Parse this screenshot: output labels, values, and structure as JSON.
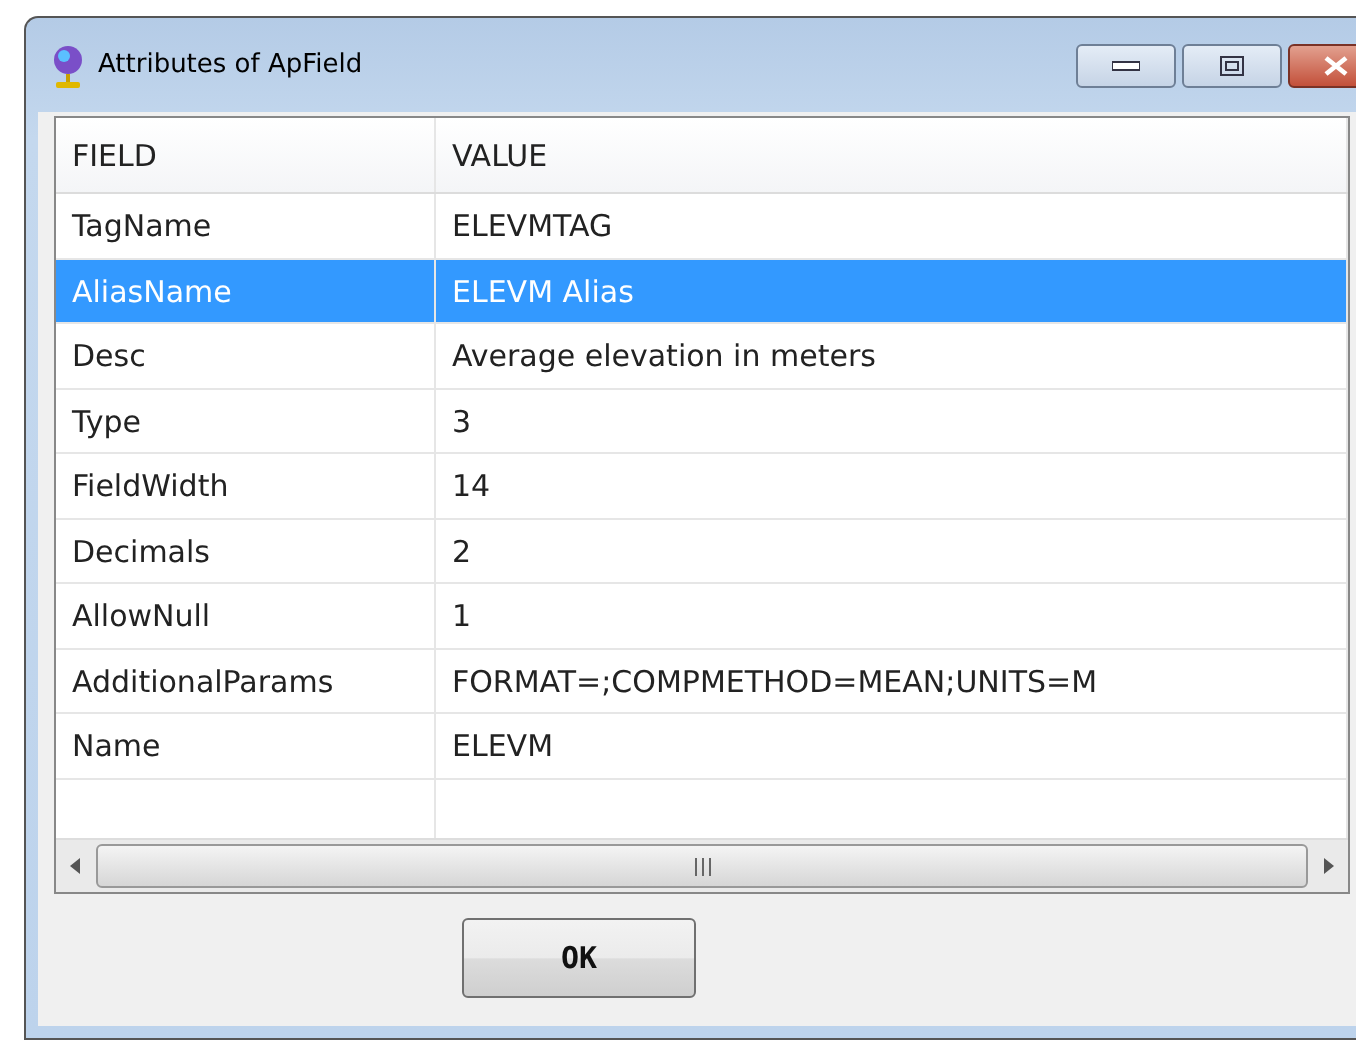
{
  "window": {
    "title": "Attributes of ApField"
  },
  "table": {
    "columns": [
      "FIELD",
      "VALUE"
    ],
    "rows": [
      {
        "field": "TagName",
        "value": "ELEVMTAG",
        "selected": false
      },
      {
        "field": "AliasName",
        "value": "ELEVM Alias",
        "selected": true
      },
      {
        "field": "Desc",
        "value": "Average elevation in meters",
        "selected": false
      },
      {
        "field": "Type",
        "value": "3",
        "selected": false
      },
      {
        "field": "FieldWidth",
        "value": "14",
        "selected": false
      },
      {
        "field": "Decimals",
        "value": "2",
        "selected": false
      },
      {
        "field": "AllowNull",
        "value": "1",
        "selected": false
      },
      {
        "field": "AdditionalParams",
        "value": "FORMAT=;COMPMETHOD=MEAN;UNITS=M",
        "selected": false
      },
      {
        "field": "Name",
        "value": "ELEVM",
        "selected": false
      }
    ]
  },
  "buttons": [
    "OK"
  ]
}
